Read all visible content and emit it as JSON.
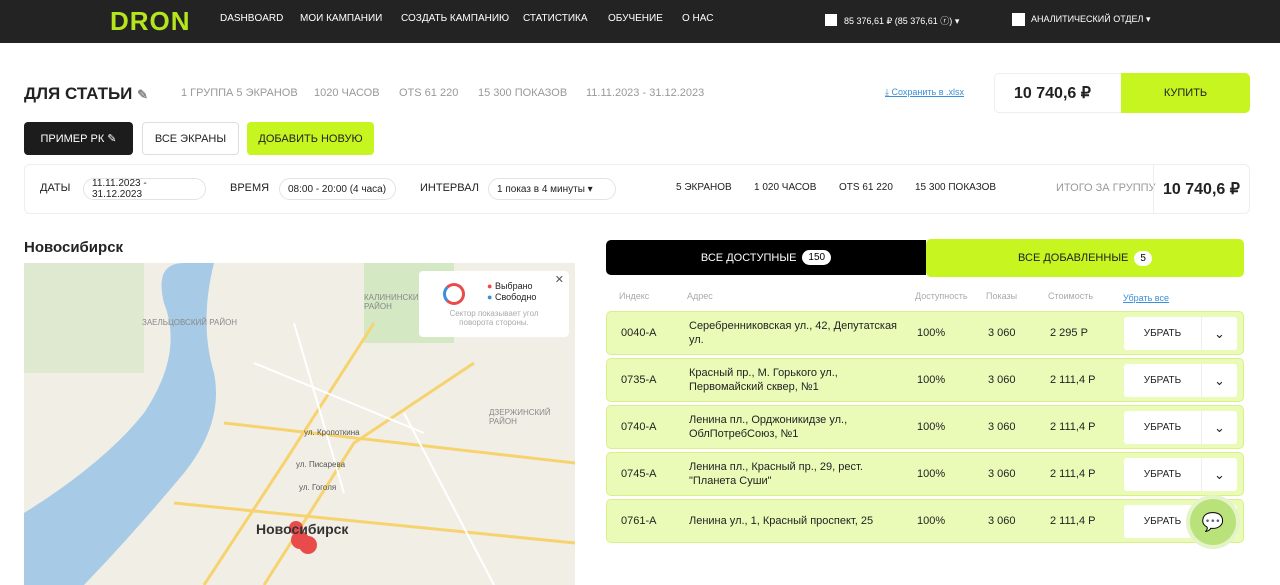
{
  "header": {
    "logo": "DRON",
    "nav": [
      "DASHBOARD",
      "МОИ КАМПАНИИ",
      "СОЗДАТЬ КАМПАНИЮ",
      "СТАТИСТИКА",
      "ОБУЧЕНИЕ",
      "О НАС"
    ],
    "balance": "85 376,61 ₽ (85 376,61 ⓡ)",
    "user": "АНАЛИТИЧЕСКИЙ ОТДЕЛ"
  },
  "campaign": {
    "title": "ДЛЯ СТАТЬИ",
    "stats": [
      "1 ГРУППА 5 ЭКРАНОВ",
      "1020 ЧАСОВ",
      "OTS 61 220",
      "15 300 ПОКАЗОВ",
      "11.11.2023 - 31.12.2023"
    ],
    "save_link": "Сохранить в .xlsx",
    "price": "10 740,6 ₽",
    "buy": "КУПИТЬ"
  },
  "groups": {
    "example": "ПРИМЕР РК",
    "all_screens": "ВСЕ ЭКРАНЫ",
    "add_new": "ДОБАВИТЬ НОВУЮ"
  },
  "filters": {
    "dates_label": "ДАТЫ",
    "dates": "11.11.2023 - 31.12.2023",
    "time_label": "ВРЕМЯ",
    "time": "08:00 - 20:00  (4 часа)",
    "interval_label": "ИНТЕРВАЛ",
    "interval": "1 показ в 4 минуты",
    "screens": "5 ЭКРАНОВ",
    "hours": "1 020 ЧАСОВ",
    "ots": "OTS 61 220",
    "shows": "15 300 ПОКАЗОВ",
    "total_label": "ИТОГО ЗА ГРУППУ",
    "total": "10 740,6 ₽"
  },
  "map": {
    "city": "Новосибирск",
    "legend_selected": "Выбрано",
    "legend_free": "Свободно",
    "legend_note": "Сектор показывает угол поворота стороны.",
    "labels": [
      "ЗАЕЛЬЦОВСКИЙ РАЙОН",
      "КАЛИНИНСКИЙ РАЙОН",
      "ДЗЕРЖИНСКИЙ РАЙОН",
      "ул. Кропоткина",
      "ул. Писарева",
      "ул. Гоголя",
      "Новосибирск"
    ]
  },
  "tabs": {
    "available": "ВСЕ ДОСТУПНЫЕ",
    "available_count": "150",
    "added": "ВСЕ ДОБАВЛЕННЫЕ",
    "added_count": "5"
  },
  "table": {
    "headers": [
      "Индекс",
      "Адрес",
      "Доступность",
      "Показы",
      "Стоимость"
    ],
    "remove_all": "Убрать все",
    "remove": "УБРАТЬ",
    "rows": [
      {
        "index": "0040-А",
        "address": "Серебренниковская ул., 42, Депутатская ул.",
        "avail": "100%",
        "shows": "3 060",
        "cost": "2 295 Р"
      },
      {
        "index": "0735-А",
        "address": "Красный пр., М. Горького ул., Первомайский сквер, №1",
        "avail": "100%",
        "shows": "3 060",
        "cost": "2 111,4 Р"
      },
      {
        "index": "0740-А",
        "address": "Ленина пл., Орджоникидзе ул., ОблПотребСоюз, №1",
        "avail": "100%",
        "shows": "3 060",
        "cost": "2 111,4 Р"
      },
      {
        "index": "0745-А",
        "address": "Ленина пл., Красный пр., 29, рест. \"Планета Суши\"",
        "avail": "100%",
        "shows": "3 060",
        "cost": "2 111,4 Р"
      },
      {
        "index": "0761-А",
        "address": "Ленина ул., 1, Красный проспект, 25",
        "avail": "100%",
        "shows": "3 060",
        "cost": "2 111,4 Р"
      }
    ]
  }
}
